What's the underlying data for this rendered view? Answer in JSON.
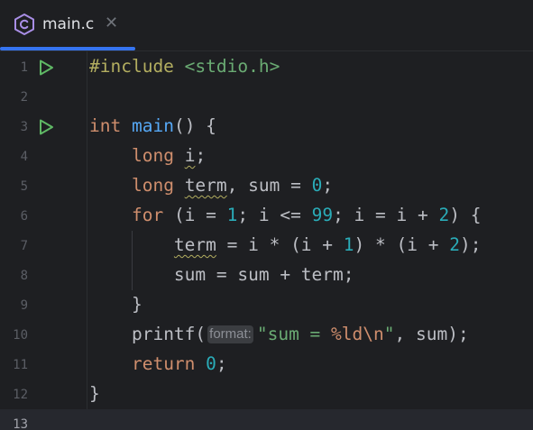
{
  "tab": {
    "title": "main.c",
    "icon": "c-language-icon",
    "close_glyph": "✕"
  },
  "colors": {
    "background": "#1e1f22",
    "keyword": "#cf8e6d",
    "function": "#56a8f5",
    "number": "#2aacb8",
    "string": "#6aab73",
    "preprocessor": "#b3ae60",
    "accent": "#3574f0",
    "run": "#5fb865"
  },
  "code": {
    "line_numbers": [
      "1",
      "2",
      "3",
      "4",
      "5",
      "6",
      "7",
      "8",
      "9",
      "10",
      "11",
      "12",
      "13"
    ],
    "line1": {
      "directive": "#include",
      "header": "<stdio.h>"
    },
    "line3": {
      "type": "int",
      "name": "main",
      "rest": "() {"
    },
    "line4": {
      "type": "long",
      "var": "i",
      "rest": ";"
    },
    "line5": {
      "type": "long",
      "var": "term",
      "mid": ", sum = ",
      "num": "0",
      "rest": ";"
    },
    "line6": {
      "kw": "for",
      "p1": " (i = ",
      "n1": "1",
      "p2": "; i <= ",
      "n2": "99",
      "p3": "; i = i + ",
      "n3": "2",
      "p4": ") {"
    },
    "line7": {
      "var": "term",
      "p1": " = i * (i + ",
      "n1": "1",
      "p2": ") * (i + ",
      "n2": "2",
      "p3": ");"
    },
    "line8": {
      "text": "sum = sum + term;"
    },
    "line9": {
      "text": "}"
    },
    "line10": {
      "fn": "printf(",
      "hint": "format:",
      "str1": "\"sum = ",
      "fmt": "%ld",
      "esc": "\\n",
      "str2": "\"",
      "rest": ", sum);"
    },
    "line11": {
      "kw": "return",
      "num": "0",
      "rest": ";"
    },
    "line12": {
      "text": "}"
    }
  }
}
